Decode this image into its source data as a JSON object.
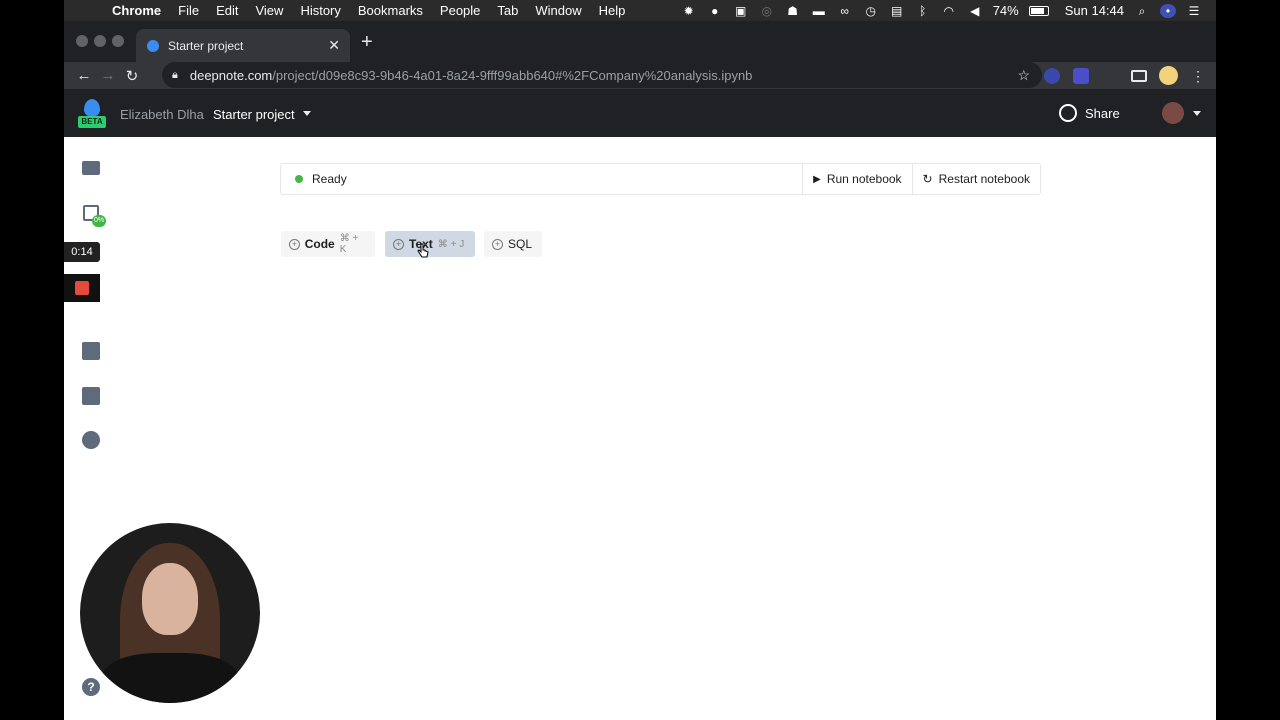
{
  "menubar": {
    "app": "Chrome",
    "items": [
      "File",
      "Edit",
      "View",
      "History",
      "Bookmarks",
      "People",
      "Tab",
      "Window",
      "Help"
    ],
    "battery": "74%",
    "clock": "Sun 14:44"
  },
  "browser": {
    "tab_title": "Starter project",
    "url_domain": "deepnote.com",
    "url_path": "/project/d09e8c93-9b46-4a01-8a24-9fff99abb640#%2FCompany%20analysis.ipynb"
  },
  "header": {
    "logo_badge": "BETA",
    "user_name": "Elizabeth Dlha",
    "project_name": "Starter project",
    "share_label": "Share"
  },
  "rail": {
    "cpu_badge": "0%",
    "timer": "0:14"
  },
  "notebook": {
    "status": "Ready",
    "run_label": "Run notebook",
    "restart_label": "Restart notebook",
    "add_blocks": [
      {
        "label": "Code",
        "shortcut": "⌘ + K"
      },
      {
        "label": "Text",
        "shortcut": "⌘ + J"
      },
      {
        "label": "SQL",
        "shortcut": ""
      }
    ]
  },
  "colors": {
    "ready": "#43b549",
    "brand_blue": "#3b8cf0",
    "record": "#e54b3c"
  }
}
